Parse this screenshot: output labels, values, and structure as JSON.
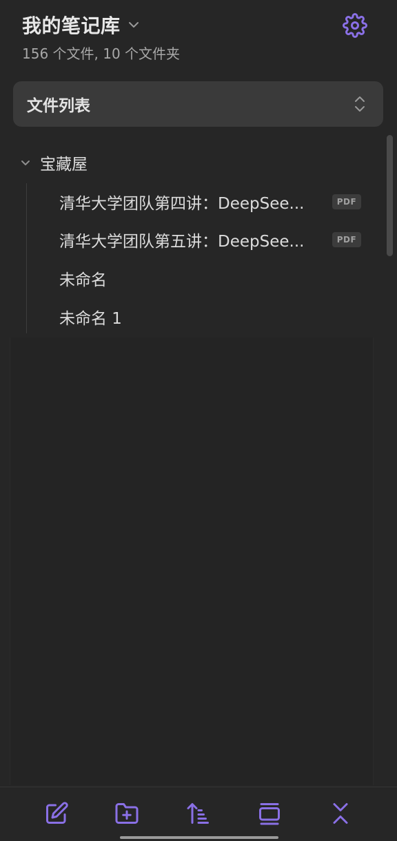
{
  "vault": {
    "name": "我的笔记库",
    "stats": "156 个文件, 10 个文件夹"
  },
  "view_selector": {
    "label": "文件列表"
  },
  "tree": {
    "folder": {
      "name": "宝藏屋",
      "expanded": true
    },
    "files": [
      {
        "name": "清华大学团队第四讲：DeepSee...",
        "badge": "PDF"
      },
      {
        "name": "清华大学团队第五讲：DeepSee...",
        "badge": "PDF"
      },
      {
        "name": "未命名",
        "badge": ""
      },
      {
        "name": "未命名 1",
        "badge": ""
      }
    ]
  },
  "toolbar": {
    "icons": [
      "new-note-icon",
      "new-folder-icon",
      "sort-icon",
      "toggle-view-icon",
      "collapse-all-icon"
    ]
  },
  "colors": {
    "accent": "#8a70e6",
    "background": "#262626",
    "panel": "#3a3a3a"
  }
}
